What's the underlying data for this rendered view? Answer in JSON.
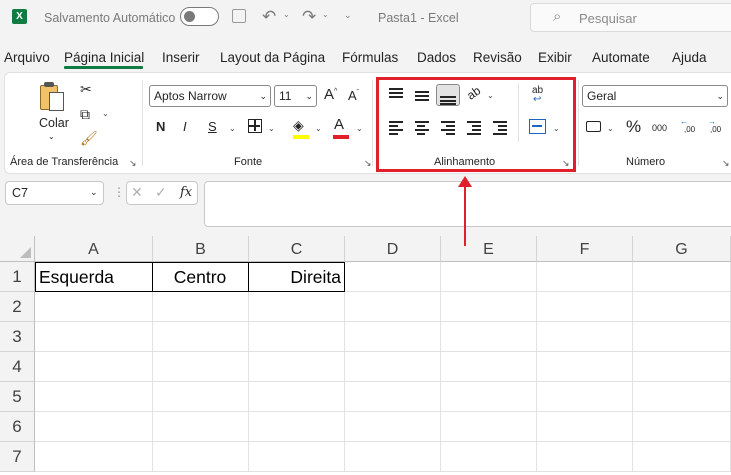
{
  "titlebar": {
    "autosave_label": "Salvamento Automático",
    "doc_title": "Pasta1  -  Excel",
    "search_placeholder": "Pesquisar"
  },
  "menu": {
    "tabs": [
      "Arquivo",
      "Página Inicial",
      "Inserir",
      "Layout da Página",
      "Fórmulas",
      "Dados",
      "Revisão",
      "Exibir",
      "Automate",
      "Ajuda"
    ],
    "active_tab": "Página Inicial"
  },
  "ribbon": {
    "clipboard": {
      "label": "Área de Transferência",
      "paste_label": "Colar"
    },
    "font": {
      "label": "Fonte",
      "font_name": "Aptos Narrow",
      "font_size": "11",
      "bold": "N",
      "italic": "I",
      "underline": "S",
      "grow": "A",
      "shrink": "A",
      "font_color_letter": "A"
    },
    "alignment": {
      "label": "Alinhamento",
      "wrap_text_icon": "ab"
    },
    "number": {
      "label": "Número",
      "format": "Geral",
      "percent": "%",
      "thousands": "000"
    },
    "highlight_color": "#e01f2a"
  },
  "formula_bar": {
    "name_box": "C7",
    "fx_label": "fx",
    "formula": ""
  },
  "sheet": {
    "columns": [
      "A",
      "B",
      "C",
      "D",
      "E",
      "F",
      "G"
    ],
    "rows": [
      "1",
      "2",
      "3",
      "4",
      "5",
      "6",
      "7"
    ],
    "cells": {
      "A1": "Esquerda",
      "B1": "Centro",
      "C1": "Direita"
    }
  },
  "colors": {
    "excel_green": "#107c41",
    "annotation_red": "#e01f2a"
  }
}
